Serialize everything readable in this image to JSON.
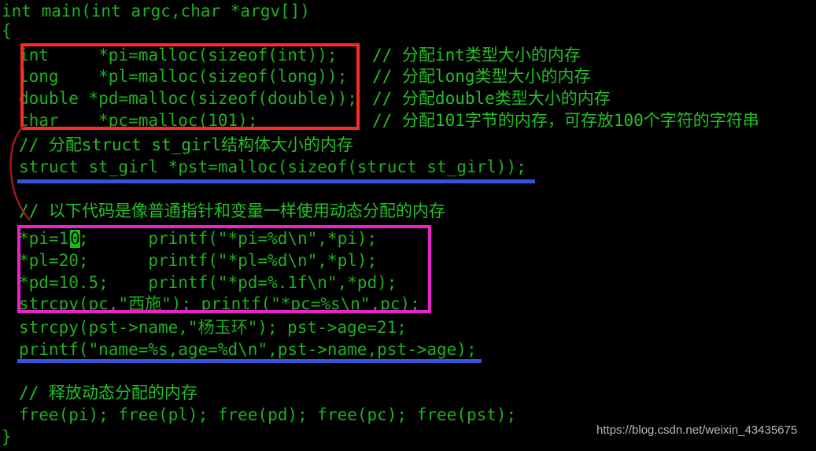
{
  "editor": {
    "background_color": "#000000",
    "code_color": "#1fb01f",
    "comment_color": "#24c024",
    "cursor_color": "#12c012"
  },
  "annotations": {
    "red_box_color": "#ff2a20",
    "magenta_box_color": "#ee22cc",
    "blue_rule_color": "#3355dd",
    "red_curve_color": "#a01818"
  },
  "code": {
    "lines": [
      {
        "text": "int main(int argc,char *argv[])",
        "indent": 0,
        "kind": "code"
      },
      {
        "text": "{",
        "indent": 0,
        "kind": "code"
      },
      {
        "text": "int     *pi=malloc(sizeof(int));",
        "indent": 1,
        "kind": "code"
      },
      {
        "text": "long    *pl=malloc(sizeof(long));",
        "indent": 1,
        "kind": "code"
      },
      {
        "text": "double *pd=malloc(sizeof(double));",
        "indent": 1,
        "kind": "code"
      },
      {
        "text": "char    *pc=malloc(101);",
        "indent": 1,
        "kind": "code"
      },
      {
        "text": "// 分配struct st_girl结构体大小的内存",
        "indent": 1,
        "kind": "comment"
      },
      {
        "text": "struct st_girl *pst=malloc(sizeof(struct st_girl));",
        "indent": 1,
        "kind": "code"
      },
      {
        "text": "",
        "indent": 1,
        "kind": "blank"
      },
      {
        "text": "// 以下代码是像普通指针和变量一样使用动态分配的内存",
        "indent": 1,
        "kind": "comment"
      },
      {
        "text": "*pi=10;      printf(\"*pi=%d\\n\",*pi);",
        "indent": 1,
        "kind": "code"
      },
      {
        "text": "*pl=20;      printf(\"*pl=%d\\n\",*pl);",
        "indent": 1,
        "kind": "code"
      },
      {
        "text": "*pd=10.5;    printf(\"*pd=%.1f\\n\",*pd);",
        "indent": 1,
        "kind": "code"
      },
      {
        "text": "strcpy(pc,\"西施\"); printf(\"*pc=%s\\n\",pc);",
        "indent": 1,
        "kind": "code"
      },
      {
        "text": "strcpy(pst->name,\"杨玉环\"); pst->age=21;",
        "indent": 1,
        "kind": "code"
      },
      {
        "text": "printf(\"name=%s,age=%d\\n\",pst->name,pst->age);",
        "indent": 1,
        "kind": "code"
      },
      {
        "text": "",
        "indent": 1,
        "kind": "blank"
      },
      {
        "text": "// 释放动态分配的内存",
        "indent": 1,
        "kind": "comment"
      },
      {
        "text": "free(pi); free(pl); free(pd); free(pc); free(pst);",
        "indent": 1,
        "kind": "code"
      },
      {
        "text": "}",
        "indent": 0,
        "kind": "code"
      }
    ],
    "trailing_comments": [
      {
        "text": "// 分配int类型大小的内存",
        "line_index": 2
      },
      {
        "text": "// 分配long类型大小的内存",
        "line_index": 3
      },
      {
        "text": "// 分配double类型大小的内存",
        "line_index": 4
      },
      {
        "text": "// 分配101字节的内存，可存放100个字符的字符串",
        "line_index": 5
      }
    ]
  },
  "cursor": {
    "character": "0",
    "on_line_index": 10
  },
  "watermark": {
    "text": "https://blog.csdn.net/weixin_43435675"
  }
}
